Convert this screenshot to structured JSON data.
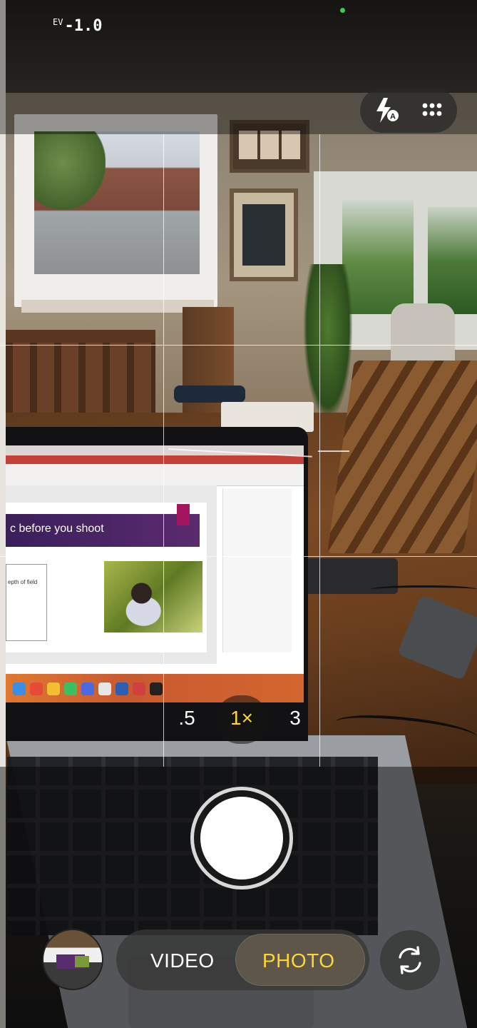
{
  "camera": {
    "exposure": {
      "prefix": "EV",
      "value": "-1.0"
    },
    "top_controls": {
      "flash": {
        "icon": "flash-auto-icon",
        "badge": "A"
      },
      "more": {
        "icon": "more-dots-icon"
      }
    },
    "grid": {
      "enabled": true
    },
    "zoom_levels": [
      {
        "label": ".5",
        "active": false
      },
      {
        "label": "1×",
        "active": true
      },
      {
        "label": "3",
        "active": false
      }
    ],
    "modes": [
      {
        "label": "VIDEO",
        "active": false
      },
      {
        "label": "PHOTO",
        "active": true
      }
    ],
    "bottom_controls": {
      "gallery": {
        "icon": "gallery-thumbnail"
      },
      "shutter": {
        "icon": "shutter-button"
      },
      "switch_camera": {
        "icon": "switch-camera-icon"
      }
    },
    "colors": {
      "accent": "#ffd43a",
      "text": "#ffffff",
      "status_dot": "#33d14a"
    }
  },
  "scene": {
    "slide_title": "c before you shoot",
    "slide_note": "epth of field"
  }
}
